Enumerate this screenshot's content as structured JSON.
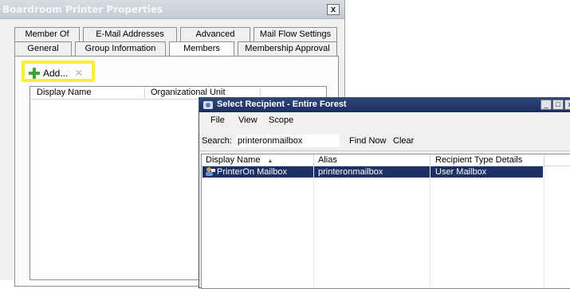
{
  "props_dialog": {
    "title": "Boardroom Printer Properties",
    "close": "x",
    "tabs_row1": [
      "Member Of",
      "E-Mail Addresses",
      "Advanced",
      "Mail Flow Settings"
    ],
    "tabs_row2": [
      "General",
      "Group Information",
      "Members",
      "Membership Approval"
    ],
    "active_tab": "Members",
    "add_label": "Add...",
    "remove_icon": "x-icon",
    "list_columns": [
      "Display Name",
      "Organizational Unit"
    ]
  },
  "select_dialog": {
    "title": "Select Recipient - Entire Forest",
    "window_buttons": [
      "_",
      "□",
      "x"
    ],
    "menu": [
      "File",
      "View",
      "Scope"
    ],
    "search_label": "Search:",
    "search_value": "printeronmailbox",
    "find_now": "Find Now",
    "clear": "Clear",
    "columns": [
      "Display Name",
      "Alias",
      "Recipient Type Details"
    ],
    "sort_indicator": "▲",
    "rows": [
      {
        "display_name": "PrinterOn Mailbox",
        "alias": "printeronmailbox",
        "type": "User Mailbox"
      }
    ]
  },
  "colors": {
    "highlight": "#f7f13d",
    "selected_row": "#1c2f66",
    "titlebar_active": "#1b2f60"
  }
}
